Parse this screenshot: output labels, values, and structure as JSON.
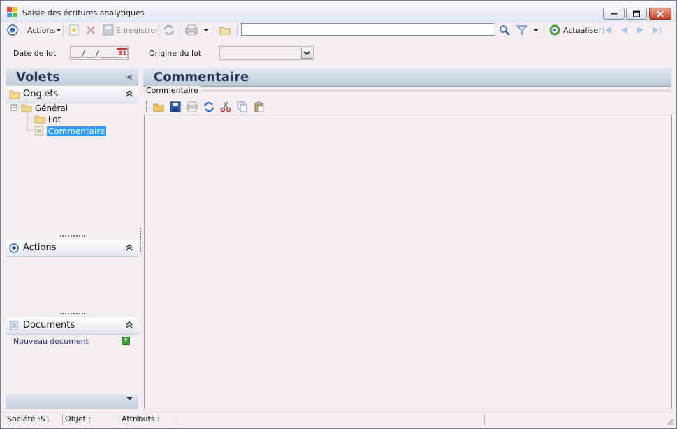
{
  "window": {
    "title": "Saisie des écritures analytiques"
  },
  "toolbar": {
    "actions_label": "Actions",
    "save_label": "Enregistrer",
    "search_value": "",
    "refresh_label": "Actualiser"
  },
  "filters": {
    "date_label": "Date de lot",
    "date_value": "__/__/____",
    "calendar_day": "31",
    "origin_label": "Origine du lot",
    "origin_value": ""
  },
  "left_panel": {
    "title": "Volets",
    "tabs_section": "Onglets",
    "tree": {
      "root": "Général",
      "children": [
        "Lot",
        "Commentaire"
      ],
      "selected": "Commentaire"
    },
    "actions_section": "Actions",
    "documents_section": "Documents",
    "new_document": "Nouveau document"
  },
  "main": {
    "title": "Commentaire",
    "group_label": "Commentaire",
    "editor_text": ""
  },
  "status": {
    "company": "Société :S1",
    "object": "Objet :",
    "attributes": "Attributs :"
  },
  "colors": {
    "accent": "#23385c",
    "selection": "#3399ff",
    "background": "#f4eef2"
  }
}
